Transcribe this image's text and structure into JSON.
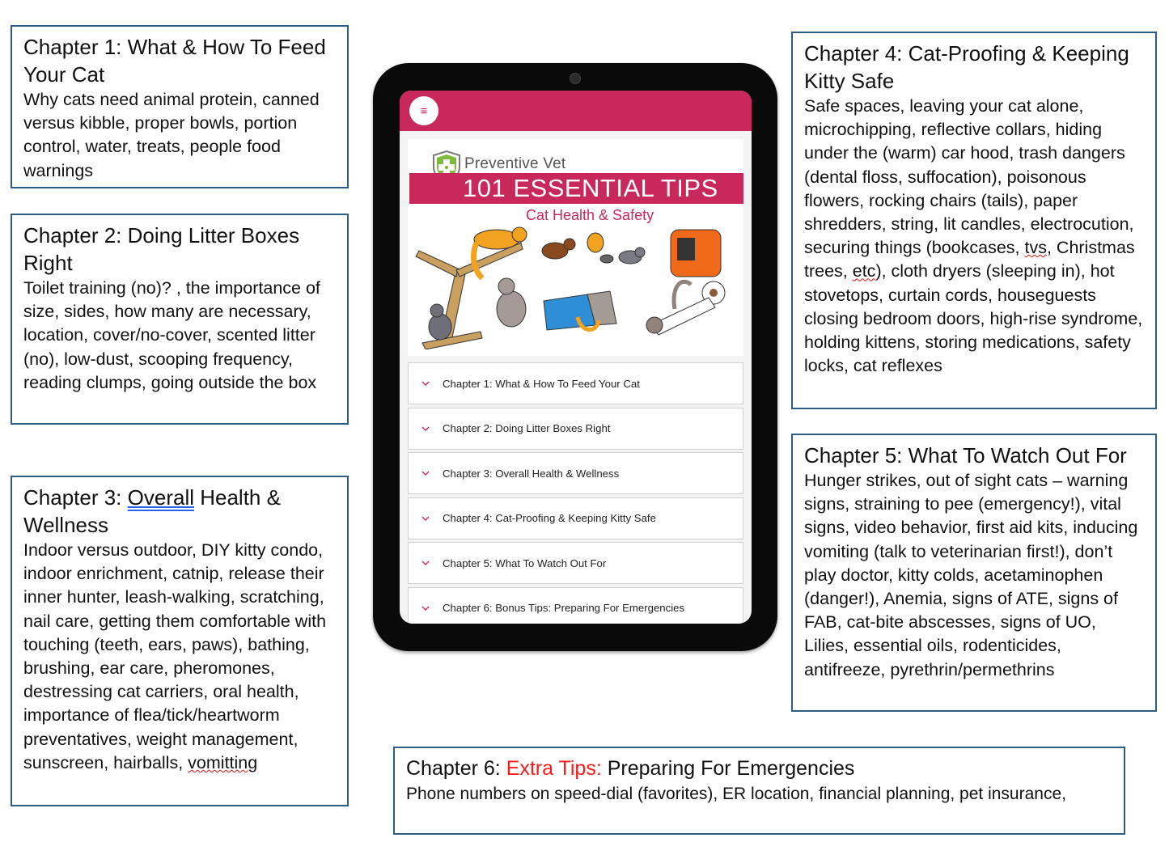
{
  "callouts": {
    "ch1": {
      "title": "Chapter 1: What & How To Feed Your Cat",
      "body": "Why cats need animal protein, canned versus kibble, proper bowls, portion control, water, treats, people food warnings"
    },
    "ch2": {
      "title": "Chapter 2: Doing Litter Boxes Right",
      "body": "Toilet training (no)? , the importance of size, sides, how many are necessary, location, cover/no-cover, scented litter (no), low-dust, scooping frequency, reading clumps, going outside the box"
    },
    "ch3": {
      "title_prefix": "Chapter 3: ",
      "title_underlined": "Overall",
      "title_suffix": " Health & Wellness",
      "body_main": "Indoor versus outdoor, DIY kitty condo, indoor enrichment, catnip, release their inner hunter, leash-walking, scratching, nail care, getting them comfortable with touching (teeth, ears, paws), bathing, brushing, ear care, pheromones, destressing cat carriers, oral health, importance of flea/tick/heartworm preventatives, weight management, sunscreen, hairballs, ",
      "body_squiggle": "vomitting"
    },
    "ch4": {
      "title": "Chapter 4: Cat-Proofing & Keeping Kitty Safe",
      "body_1": "Safe spaces, leaving your cat alone, microchipping, reflective collars, hiding under the (warm) car hood, trash dangers (dental floss, suffocation), poisonous flowers, rocking chairs (tails), paper shredders, string, lit candles, electrocution, securing things (bookcases, ",
      "squiggle_1": "tvs",
      "body_2": ", Christmas trees, ",
      "squiggle_2": "etc",
      "body_3": "), cloth dryers (sleeping in), hot stovetops, curtain cords, houseguests closing bedroom doors, high-rise syndrome, holding kittens, storing medications, safety locks, cat reflexes"
    },
    "ch5": {
      "title": "Chapter 5: What To Watch Out For",
      "body": "Hunger strikes, out of sight cats – warning signs, straining to pee (emergency!), vital signs, video behavior, first aid kits, inducing vomiting (talk to veterinarian first!), don’t play doctor, kitty colds, acetaminophen (danger!), Anemia, signs of ATE, signs of FAB, cat-bite abscesses, signs of UO, Lilies, essential oils, rodenticides, antifreeze, pyrethrin/permethrins"
    },
    "ch6": {
      "title_prefix": "Chapter 6: ",
      "title_highlight": "Extra Tips:",
      "title_suffix": " Preparing For Emergencies",
      "body": "Phone numbers on speed-dial (favorites), ER location, financial planning,  pet insurance,"
    }
  },
  "tablet": {
    "menu_icon": "hamburger-menu-icon",
    "banner": {
      "brand": "Preventive Vet",
      "title": "101 ESSENTIAL TIPS",
      "subtitle": "Cat Health & Safety"
    },
    "chapters": [
      {
        "label": "Chapter 1: What & How To Feed Your Cat"
      },
      {
        "label": "Chapter 2: Doing Litter Boxes Right"
      },
      {
        "label": "Chapter 3: Overall Health & Wellness"
      },
      {
        "label": "Chapter 4: Cat-Proofing & Keeping Kitty Safe"
      },
      {
        "label": "Chapter 5: What To Watch Out For"
      },
      {
        "label": "Chapter 6: Bonus Tips: Preparing For Emergencies"
      }
    ]
  },
  "colors": {
    "brand_pink": "#c9295a",
    "callout_border": "#2b5d86",
    "highlight_red": "#ff1a1a"
  }
}
